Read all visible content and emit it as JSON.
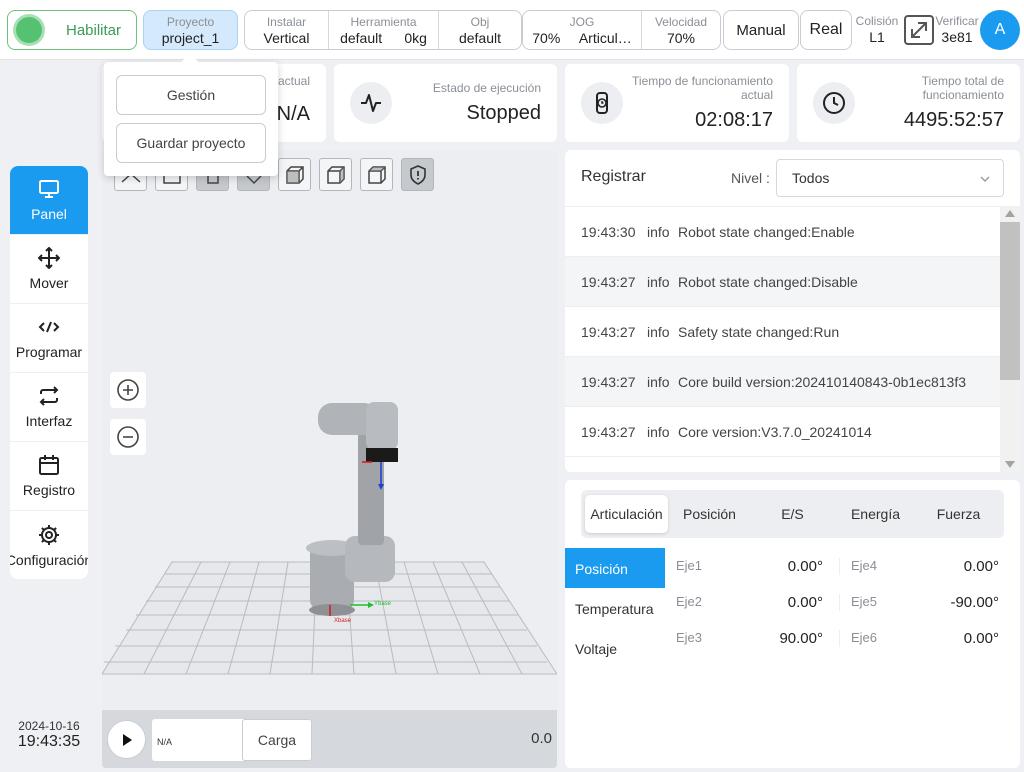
{
  "topbar": {
    "enable_label": "Habilitar",
    "project": {
      "label": "Proyecto",
      "value": "project_1"
    },
    "install": {
      "label": "Instalar",
      "value": "Vertical"
    },
    "tool": {
      "label": "Herramienta",
      "name": "default",
      "load": "0kg"
    },
    "obj": {
      "label": "Obj",
      "value": "default"
    },
    "jog": {
      "label": "JOG",
      "percent": "70%",
      "mode": "Articul…"
    },
    "speed": {
      "label": "Velocidad",
      "value": "70%"
    },
    "manual_label": "Manual",
    "real_label": "Real",
    "collision": {
      "label": "Colisión",
      "value": "L1"
    },
    "verify": {
      "label": "Verificar",
      "value": "3e81"
    },
    "avatar_initial": "A"
  },
  "dropdown": {
    "items": [
      "Gestión",
      "Guardar proyecto"
    ]
  },
  "stats": {
    "current": {
      "label": "actual",
      "value": "N/A"
    },
    "exec_state": {
      "label": "Estado de ejecución",
      "value": "Stopped"
    },
    "uptime": {
      "label": "Tiempo de funcionamiento actual",
      "value": "02:08:17"
    },
    "total_uptime": {
      "label": "Tiempo total de funcionamiento",
      "value": "4495:52:57"
    }
  },
  "sidebar": {
    "items": [
      {
        "label": "Panel",
        "icon": "monitor-icon"
      },
      {
        "label": "Mover",
        "icon": "move-icon"
      },
      {
        "label": "Programar",
        "icon": "code-icon"
      },
      {
        "label": "Interfaz",
        "icon": "swap-icon"
      },
      {
        "label": "Registro",
        "icon": "calendar-icon"
      },
      {
        "label": "Configuración",
        "icon": "gear-icon"
      }
    ],
    "date": "2024-10-16",
    "time": "19:43:35"
  },
  "viewport": {
    "program_value": "N/A",
    "load_label": "Carga",
    "speed_value": "0.0",
    "axis_labels": {
      "x": "Xbase",
      "y": "Ybase"
    }
  },
  "log": {
    "title": "Registrar",
    "level_label": "Nivel",
    "level_sep": ":",
    "level_value": "Todos",
    "rows": [
      {
        "time": "19:43:30",
        "level": "info",
        "message": "Robot state changed:Enable"
      },
      {
        "time": "19:43:27",
        "level": "info",
        "message": "Robot state changed:Disable"
      },
      {
        "time": "19:43:27",
        "level": "info",
        "message": "Safety state changed:Run"
      },
      {
        "time": "19:43:27",
        "level": "info",
        "message": "Core build version:202410140843-0b1ec813f3"
      },
      {
        "time": "19:43:27",
        "level": "info",
        "message": "Core version:V3.7.0_20241014"
      }
    ]
  },
  "joints": {
    "tabs": [
      "Articulación",
      "Posición",
      "E/S",
      "Energía",
      "Fuerza"
    ],
    "active_tab": "Articulación",
    "sub_menu": [
      "Posición",
      "Temperatura",
      "Voltaje"
    ],
    "rows": [
      [
        {
          "name": "Eje1",
          "value": "0.00°"
        },
        {
          "name": "Eje4",
          "value": "0.00°"
        }
      ],
      [
        {
          "name": "Eje2",
          "value": "0.00°"
        },
        {
          "name": "Eje5",
          "value": "-90.00°"
        }
      ],
      [
        {
          "name": "Eje3",
          "value": "90.00°"
        },
        {
          "name": "Eje6",
          "value": "0.00°"
        }
      ]
    ]
  },
  "colors": {
    "accent": "#1a9bf0",
    "enable_green": "#56c271"
  }
}
